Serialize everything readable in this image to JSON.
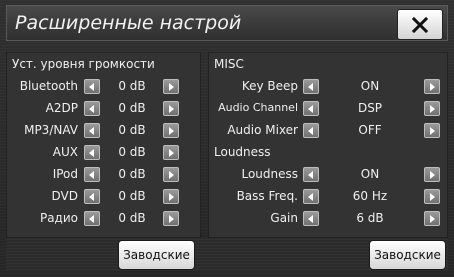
{
  "title": "Расширенные настрой",
  "close_icon": "x-icon",
  "volume_section": {
    "header": "Уст. уровня  громкости",
    "rows": [
      {
        "label": "Bluetooth",
        "value": "0 dB"
      },
      {
        "label": "A2DP",
        "value": "0 dB"
      },
      {
        "label": "MP3/NAV",
        "value": "0 dB"
      },
      {
        "label": "AUX",
        "value": "0 dB"
      },
      {
        "label": "IPod",
        "value": "0 dB"
      },
      {
        "label": "DVD",
        "value": "0 dB"
      },
      {
        "label": "Радио",
        "value": "0 dB"
      }
    ],
    "default_label": "Заводские"
  },
  "misc_section": {
    "header": "MISC",
    "rows": [
      {
        "label": "Key Beep",
        "value": "ON"
      },
      {
        "label": "Audio Channel",
        "value": "DSP"
      },
      {
        "label": "Audio Mixer",
        "value": "OFF"
      }
    ],
    "loudness_header": "Loudness",
    "loudness_rows": [
      {
        "label": "Loudness",
        "value": "ON"
      },
      {
        "label": "Bass Freq.",
        "value": "60 Hz"
      },
      {
        "label": "Gain",
        "value": "6 dB"
      }
    ],
    "default_label": "Заводские"
  },
  "icons": {
    "decrease": "left-arrow-icon",
    "increase": "right-arrow-icon"
  }
}
